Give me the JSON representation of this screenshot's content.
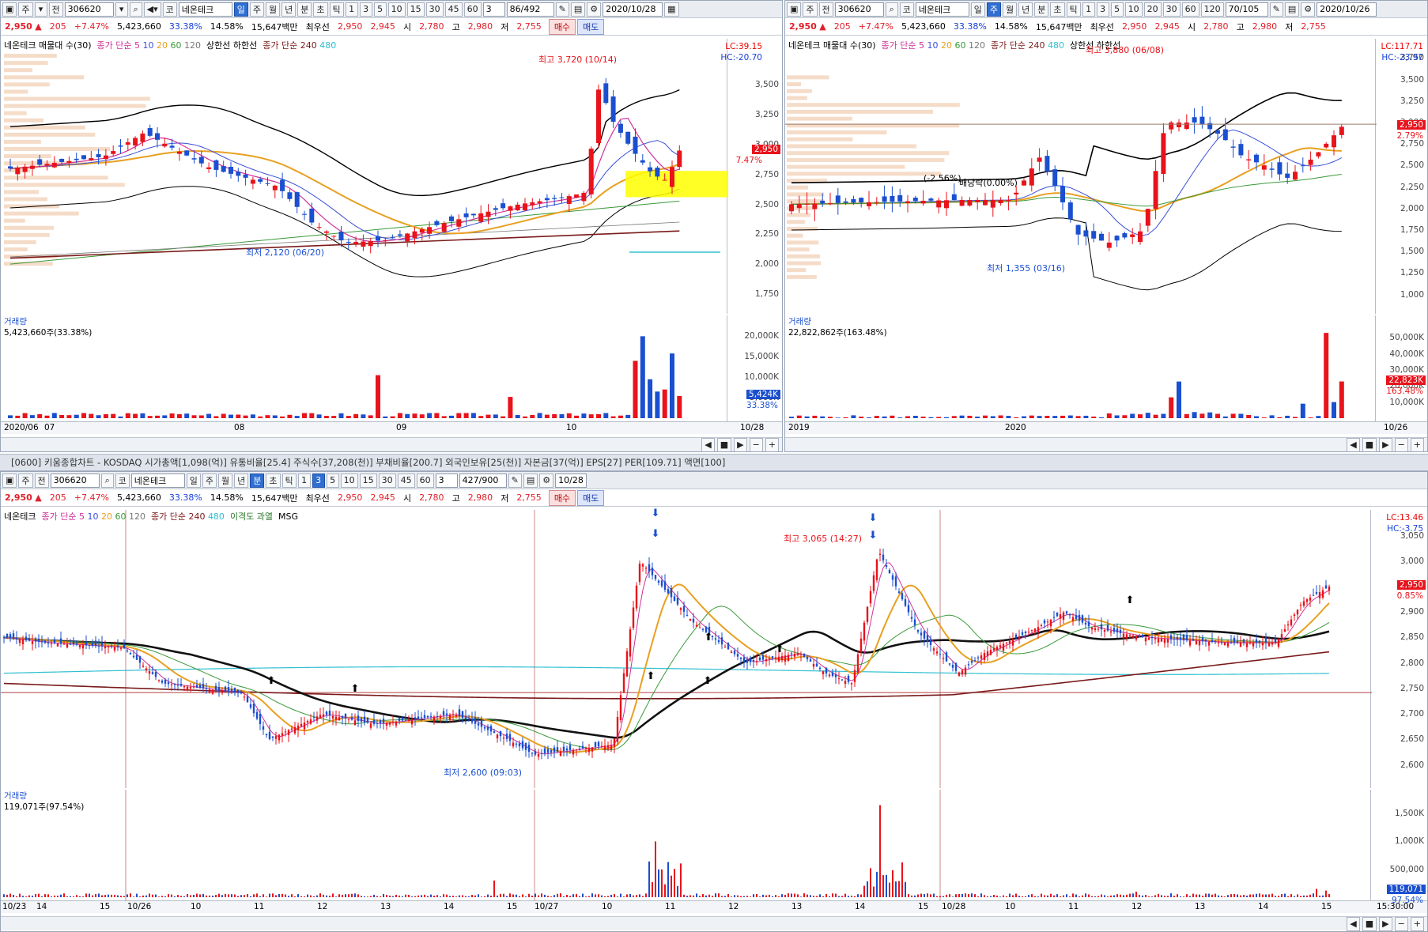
{
  "common": {
    "code": "306620",
    "name": "네온테크",
    "price": "2,950",
    "change": "205",
    "change_pct": "+7.47%",
    "volume": "5,423,660",
    "vol_ratio": "33.38%",
    "turnover": "14.58%",
    "amount": "15,647백만",
    "best_label": "최우선",
    "best_ask": "2,950",
    "best_bid": "2,945",
    "open_label": "시",
    "open": "2,780",
    "high_label": "고",
    "high": "2,980",
    "low_label": "저",
    "low": "2,755",
    "buy_label": "매수",
    "sell_label": "매도",
    "tb_ju": "주",
    "tb_jeon": "전",
    "tb_ko": "코",
    "tb_day": "일",
    "tb_week": "주",
    "tb_month": "월",
    "tb_year": "년",
    "tb_min": "분",
    "tb_sec": "초",
    "tb_tick": "틱",
    "periods": [
      "1",
      "3",
      "5",
      "10",
      "15",
      "30",
      "45",
      "60"
    ],
    "period_box": "3"
  },
  "daily": {
    "counter": "86/492",
    "date": "2020/10/28",
    "legend": {
      "name": "네온테크 매물대 수(30)",
      "ma": "종가 단순",
      "ma_vals": [
        "5",
        "10",
        "20",
        "60",
        "120"
      ],
      "limits": "상한선 하한선",
      "ma2": "종가 단순 240",
      "ma2_val": "480"
    },
    "lc": "LC:39.15",
    "hc": "HC:-20.70",
    "price_tag": "2,950",
    "price_pct": "7.47%",
    "ticks": [
      "3,500",
      "3,250",
      "3,000",
      "2,750",
      "2,500",
      "2,250",
      "2,000",
      "1,750"
    ],
    "high_ann": "최고 3,720 (10/14)",
    "low_ann": "최저 2,120 (06/20)",
    "vol_title": "거래량",
    "vol_text": "5,423,660주(33.38%)",
    "vol_ticks": [
      "20,000K",
      "15,000K",
      "10,000K",
      "5,000K"
    ],
    "vol_tag": "5,424K",
    "vol_tag2": "33.38%",
    "x_labels": [
      "2020/06",
      "07",
      "08",
      "09",
      "10",
      "10/28"
    ]
  },
  "weekly": {
    "counter": "70/105",
    "date": "2020/10/26",
    "legend": {
      "name": "네온테크 매물대 수(30)",
      "ma": "종가 단순",
      "ma_vals": [
        "5",
        "10",
        "20",
        "60",
        "120"
      ],
      "ma2": "종가 단순 240",
      "ma2_val": "480",
      "limits": "상한선 하한선"
    },
    "lc": "LC:117.71",
    "hc": "HC:-23.97",
    "price_tag": "2,950",
    "price_pct": "2.79%",
    "ticks": [
      "3,750",
      "3,500",
      "3,250",
      "3,000",
      "2,750",
      "2,500",
      "2,250",
      "2,000",
      "1,750",
      "1,500",
      "1,250",
      "1,000"
    ],
    "high_ann": "최고 3,880 (06/08)",
    "low_ann": "최저 1,355 (03/16)",
    "ann1": "(-2.56%)",
    "ann2": "배당락(0.00%)",
    "vol_title": "거래량",
    "vol_text": "22,822,862주(163.48%)",
    "vol_ticks": [
      "50,000K",
      "40,000K",
      "30,000K",
      "20,000K",
      "10,000K"
    ],
    "vol_tag": "22,823K",
    "vol_tag2": "163.48%",
    "x_labels": [
      "2019",
      "2020",
      "10/26"
    ],
    "periods": [
      "1",
      "3",
      "5",
      "10",
      "20",
      "30",
      "60",
      "120"
    ]
  },
  "minute": {
    "title": "[0600] 키움종합차트 - KOSDAQ 시가총액[1,098(억)] 유통비율[25.4] 주식수[37,208(천)] 부채비율[200.7] 외국인보유[25(천)] 자본금[37(억)] EPS[27] PER[109.71] 액면[100]",
    "counter": "427/900",
    "date": "10/28",
    "periods": [
      "1",
      "3",
      "5",
      "10",
      "15",
      "30",
      "45",
      "60"
    ],
    "legend": {
      "name": "네온테크",
      "ma": "종가 단순",
      "ma_vals": [
        "5",
        "10",
        "20",
        "60",
        "120"
      ],
      "ma2": "종가 단순 240",
      "ma2_val": "480",
      "extra": "이격도 과열",
      "msg": "MSG"
    },
    "lc": "LC:13.46",
    "hc": "HC:-3.75",
    "price_tag": "2,950",
    "price_pct": "0.85%",
    "ticks": [
      "3,050",
      "3,000",
      "2,950",
      "2,900",
      "2,850",
      "2,800",
      "2,750",
      "2,700",
      "2,650",
      "2,600"
    ],
    "high_ann": "최고 3,065 (14:27)",
    "low_ann": "최저 2,600 (09:03)",
    "vol_title": "거래량",
    "vol_text": "119,071주(97.54%)",
    "vol_ticks": [
      "1,500K",
      "1,000K",
      "500,000"
    ],
    "vol_tag": "119,071",
    "vol_tag2": "97.54%",
    "x_labels": [
      "10/23",
      "14",
      "15",
      "10/26",
      "10",
      "11",
      "12",
      "13",
      "14",
      "15",
      "10/27",
      "10",
      "11",
      "12",
      "13",
      "14",
      "15",
      "10/28",
      "10",
      "11",
      "12",
      "13",
      "14",
      "15",
      "15:30:00"
    ]
  },
  "colors": {
    "up": "#e8131b",
    "down": "#1a4fd0",
    "ma5": "#d0309a",
    "ma10": "#3a4fd8",
    "ma20": "#e8a020",
    "ma60": "#3a9a3a",
    "ma120": "#777777",
    "ma240": "#7a1a1a",
    "ma480": "#30c0d0",
    "band": "#000000",
    "highlight": "#ffff00"
  }
}
